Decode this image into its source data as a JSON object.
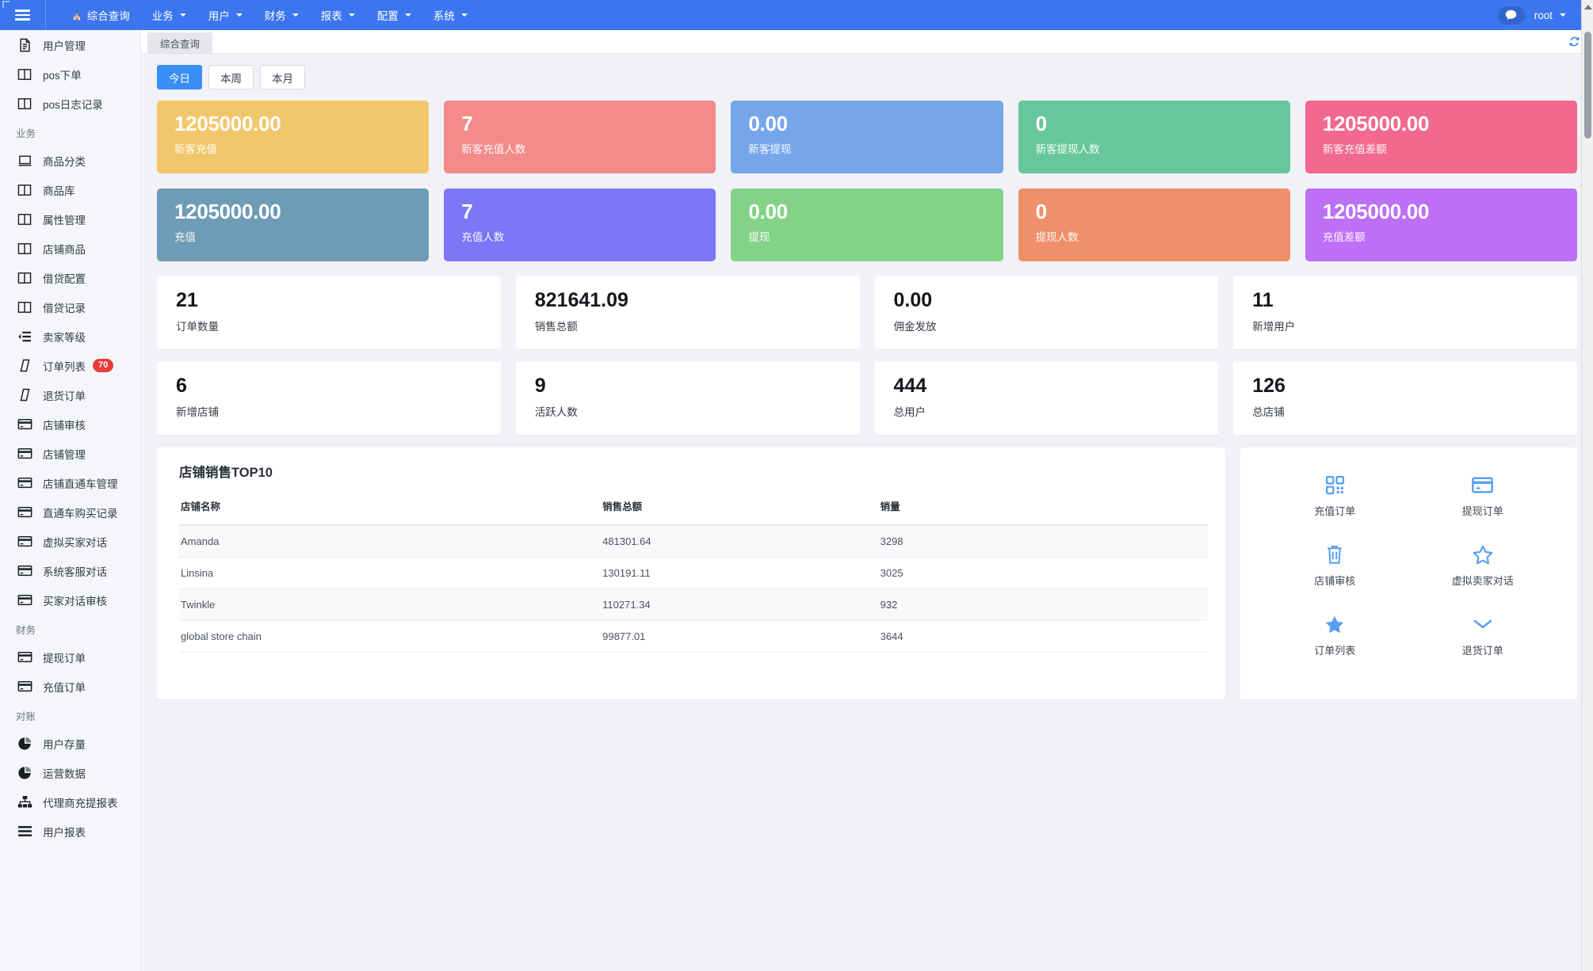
{
  "navbar": {
    "burger_icon": "hamburger-menu-icon",
    "links": [
      {
        "label": "综合查询",
        "icon": "home-icon",
        "has_caret": false
      },
      {
        "label": "业务",
        "icon": "",
        "has_caret": true
      },
      {
        "label": "用户",
        "icon": "",
        "has_caret": true
      },
      {
        "label": "财务",
        "icon": "",
        "has_caret": true
      },
      {
        "label": "报表",
        "icon": "",
        "has_caret": true
      },
      {
        "label": "配置",
        "icon": "",
        "has_caret": true
      },
      {
        "label": "系统",
        "icon": "",
        "has_caret": true
      }
    ],
    "chat_icon": "chat-bubble-icon",
    "user": "root",
    "accent_color": "#3b76ef"
  },
  "tabstrip": {
    "tabs": [
      {
        "label": "综合查询",
        "active": true
      }
    ],
    "refresh_icon": "refresh-icon"
  },
  "sidebar": {
    "items": [
      {
        "label": "用户管理",
        "icon": "document-icon",
        "badge": null,
        "type": "item"
      },
      {
        "label": "pos下单",
        "icon": "columns-icon",
        "badge": null,
        "type": "item"
      },
      {
        "label": "pos日志记录",
        "icon": "columns-icon",
        "badge": null,
        "type": "item"
      },
      {
        "label": "业务",
        "icon": "",
        "badge": null,
        "type": "group"
      },
      {
        "label": "商品分类",
        "icon": "desktop-icon",
        "badge": null,
        "type": "item"
      },
      {
        "label": "商品库",
        "icon": "columns-icon",
        "badge": null,
        "type": "item"
      },
      {
        "label": "属性管理",
        "icon": "columns-icon",
        "badge": null,
        "type": "item"
      },
      {
        "label": "店铺商品",
        "icon": "columns-icon",
        "badge": null,
        "type": "item"
      },
      {
        "label": "借贷配置",
        "icon": "columns-icon",
        "badge": null,
        "type": "item"
      },
      {
        "label": "借贷记录",
        "icon": "columns-icon",
        "badge": null,
        "type": "item"
      },
      {
        "label": "卖家等级",
        "icon": "indent-list-icon",
        "badge": null,
        "type": "item"
      },
      {
        "label": "订单列表",
        "icon": "slash-icon",
        "badge": "70",
        "type": "item"
      },
      {
        "label": "退货订单",
        "icon": "slash-icon",
        "badge": null,
        "type": "item"
      },
      {
        "label": "店铺审核",
        "icon": "credit-card-icon",
        "badge": null,
        "type": "item"
      },
      {
        "label": "店铺管理",
        "icon": "credit-card-icon",
        "badge": null,
        "type": "item"
      },
      {
        "label": "店铺直通车管理",
        "icon": "credit-card-icon",
        "badge": null,
        "type": "item"
      },
      {
        "label": "直通车购买记录",
        "icon": "credit-card-icon",
        "badge": null,
        "type": "item"
      },
      {
        "label": "虚拟买家对话",
        "icon": "credit-card-icon",
        "badge": null,
        "type": "item"
      },
      {
        "label": "系统客服对话",
        "icon": "credit-card-icon",
        "badge": null,
        "type": "item"
      },
      {
        "label": "买家对话审核",
        "icon": "credit-card-icon",
        "badge": null,
        "type": "item"
      },
      {
        "label": "财务",
        "icon": "",
        "badge": null,
        "type": "group"
      },
      {
        "label": "提现订单",
        "icon": "credit-card-icon",
        "badge": null,
        "type": "item"
      },
      {
        "label": "充值订单",
        "icon": "credit-card-icon",
        "badge": null,
        "type": "item"
      },
      {
        "label": "对账",
        "icon": "",
        "badge": null,
        "type": "group"
      },
      {
        "label": "用户存量",
        "icon": "pie-chart-icon",
        "badge": null,
        "type": "item"
      },
      {
        "label": "运营数据",
        "icon": "pie-chart-icon",
        "badge": null,
        "type": "item"
      },
      {
        "label": "代理商充提报表",
        "icon": "sitemap-icon",
        "badge": null,
        "type": "item"
      },
      {
        "label": "用户报表",
        "icon": "list-icon",
        "badge": null,
        "type": "item"
      }
    ]
  },
  "main": {
    "range_buttons": [
      {
        "label": "今日",
        "active": true
      },
      {
        "label": "本周",
        "active": false
      },
      {
        "label": "本月",
        "active": false
      }
    ],
    "color_tiles_row1": [
      {
        "value": "1205000.00",
        "label": "新客充值",
        "color": "#f2c66a"
      },
      {
        "value": "7",
        "label": "新客充值人数",
        "color": "#f48b8b"
      },
      {
        "value": "0.00",
        "label": "新客提现",
        "color": "#76a6ea"
      },
      {
        "value": "0",
        "label": "新客提现人数",
        "color": "#67c79b"
      },
      {
        "value": "1205000.00",
        "label": "新客充值差额",
        "color": "#f2688f"
      }
    ],
    "color_tiles_row2": [
      {
        "value": "1205000.00",
        "label": "充值",
        "color": "#6e9cb5"
      },
      {
        "value": "7",
        "label": "充值人数",
        "color": "#7b77f7"
      },
      {
        "value": "0.00",
        "label": "提现",
        "color": "#84d288"
      },
      {
        "value": "0",
        "label": "提现人数",
        "color": "#f0906a"
      },
      {
        "value": "1205000.00",
        "label": "充值差额",
        "color": "#bd6ff5"
      }
    ],
    "white_tiles_row1": [
      {
        "value": "21",
        "label": "订单数量"
      },
      {
        "value": "821641.09",
        "label": "销售总额"
      },
      {
        "value": "0.00",
        "label": "佣金发放"
      },
      {
        "value": "11",
        "label": "新增用户"
      }
    ],
    "white_tiles_row2": [
      {
        "value": "6",
        "label": "新增店铺"
      },
      {
        "value": "9",
        "label": "活跃人数"
      },
      {
        "value": "444",
        "label": "总用户"
      },
      {
        "value": "126",
        "label": "总店铺"
      }
    ],
    "top10": {
      "title": "店铺销售TOP10",
      "columns": [
        "店铺名称",
        "销售总额",
        "销量"
      ],
      "rows": [
        [
          "Amanda",
          "481301.64",
          "3298"
        ],
        [
          "Linsina",
          "130191.11",
          "3025"
        ],
        [
          "Twinkle",
          "110271.34",
          "932"
        ],
        [
          "global store chain",
          "99877.01",
          "3644"
        ]
      ]
    },
    "quick_links": [
      {
        "label": "充值订单",
        "icon": "qrcode-icon"
      },
      {
        "label": "提现订单",
        "icon": "credit-card-icon"
      },
      {
        "label": "店铺审核",
        "icon": "trash-icon"
      },
      {
        "label": "虚拟卖家对话",
        "icon": "star-outline-icon"
      },
      {
        "label": "订单列表",
        "icon": "star-filled-icon"
      },
      {
        "label": "退货订单",
        "icon": "chevron-down-icon"
      }
    ],
    "quick_icon_color": "#5aa0f0"
  }
}
